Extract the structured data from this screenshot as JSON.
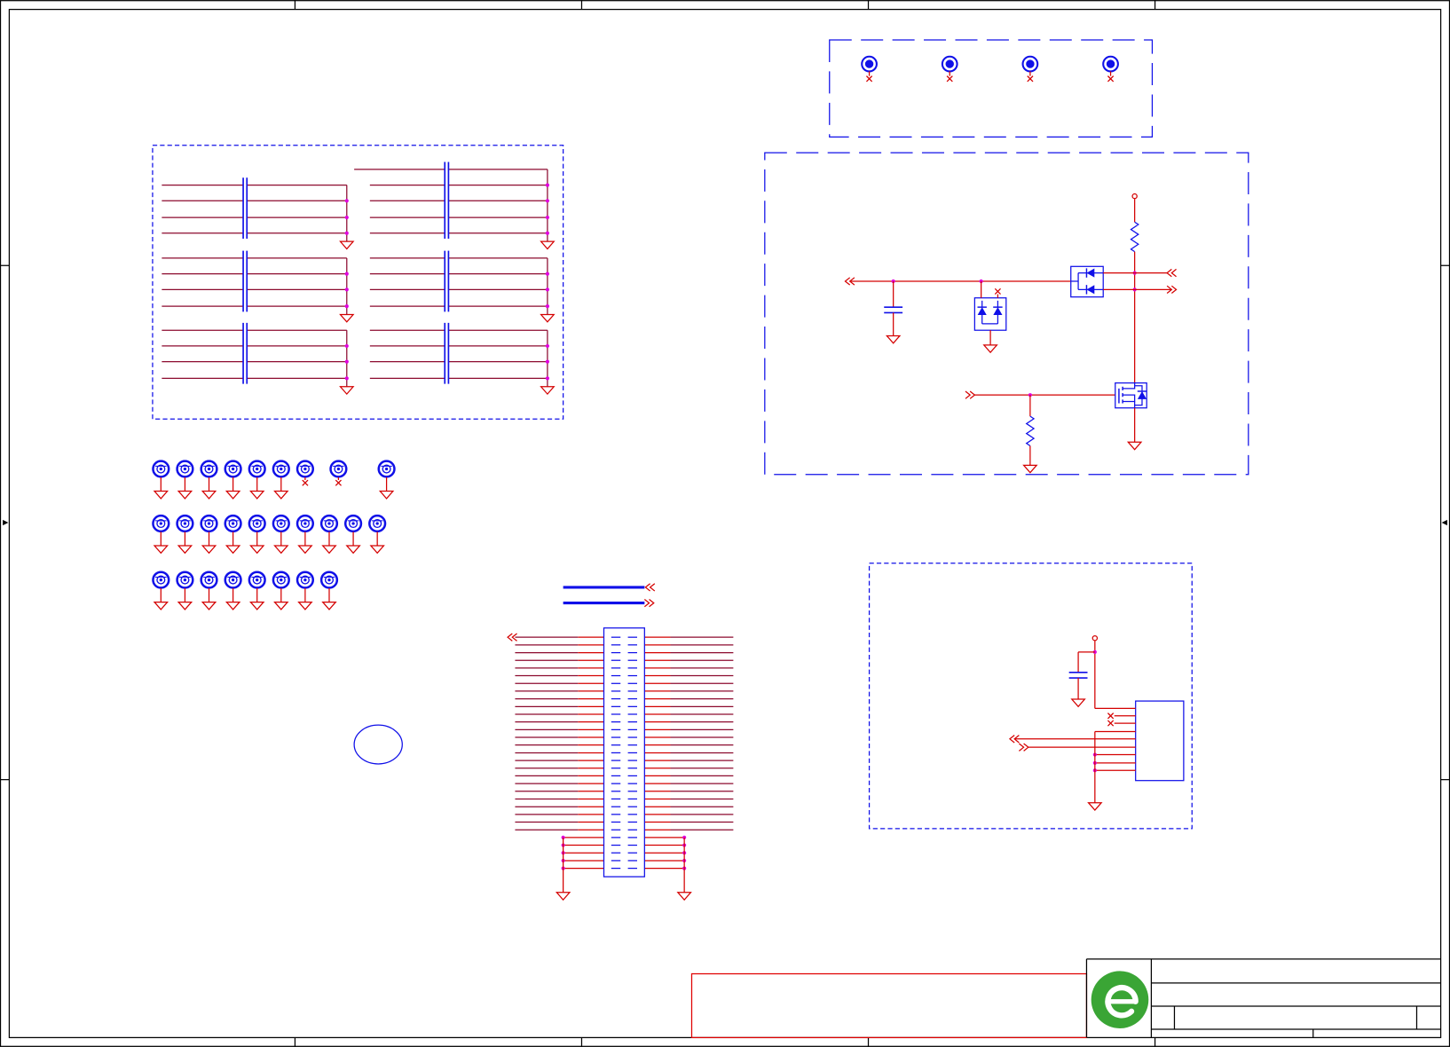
{
  "colors": {
    "background": "#ffffff",
    "frame": "#000000",
    "wire": "#d40000",
    "net_wire": "#8c0a2e",
    "component": "#1010e8",
    "junction": "#e000e0",
    "title_block_border": "#e00000",
    "logo": "#3aa535"
  },
  "icons": {
    "mounting_hole": "mounting-hole-icon",
    "fiducial": "fiducial-icon",
    "ground": "ground-icon",
    "power": "power-port-icon",
    "capacitor": "capacitor-icon",
    "resistor": "resistor-icon",
    "diode": "diode-icon",
    "mosfet": "mosfet-icon",
    "connector": "connector-icon",
    "no_connect": "no-connect-icon",
    "logo": "company-logo-icon"
  }
}
